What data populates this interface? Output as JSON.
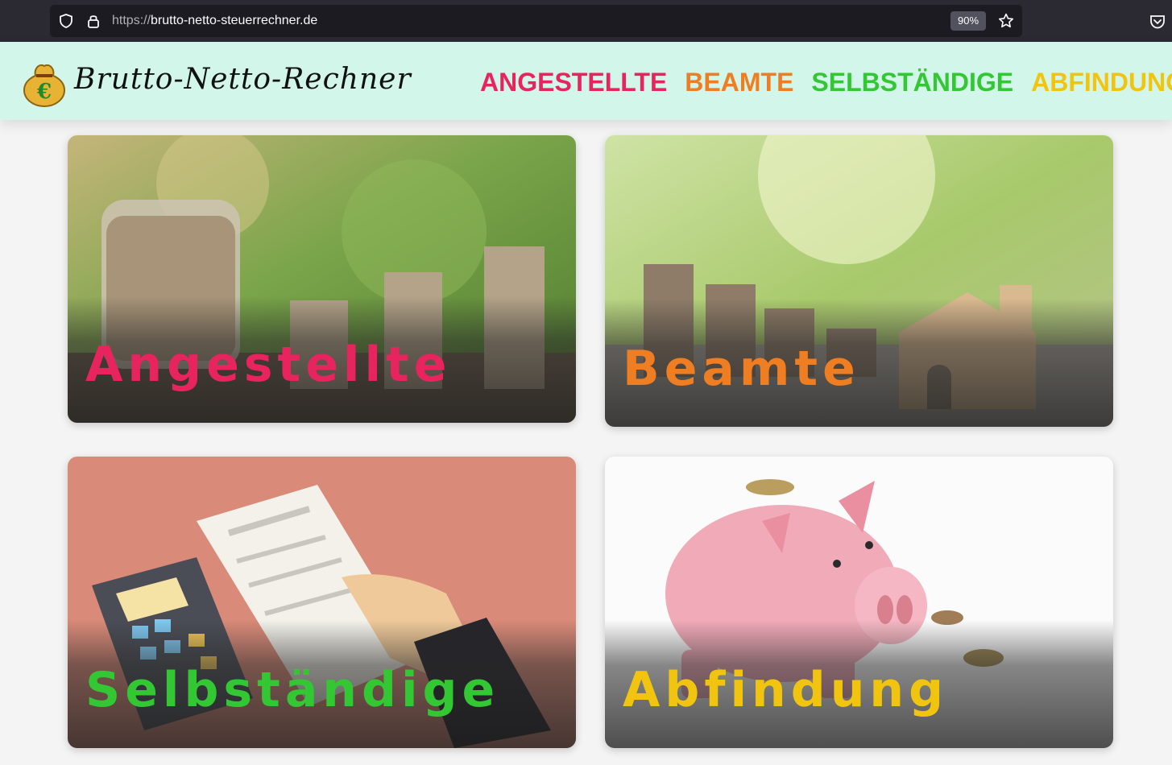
{
  "browser": {
    "url_scheme": "https://",
    "url_host": "brutto-netto-steuerrechner.de",
    "zoom": "90%",
    "icons": [
      "shield-icon",
      "lock-icon",
      "star-icon",
      "pocket-icon"
    ]
  },
  "header": {
    "logo_text": "Brutto-Netto-Rechner",
    "logo_icon": "money-bag-icon",
    "nav": [
      {
        "label": "ANGESTELLTE",
        "color": "#e8245f"
      },
      {
        "label": "BEAMTE",
        "color": "#ef7d22"
      },
      {
        "label": "SELBSTÄNDIGE",
        "color": "#33c734"
      },
      {
        "label": "ABFINDUNG",
        "color": "#f1c40f"
      }
    ],
    "background": "#d2f7ea"
  },
  "cards": [
    {
      "label": "Angestellte",
      "color": "#e8245f",
      "image": "coin-jar-and-stacks"
    },
    {
      "label": "Beamte",
      "color": "#ef7d22",
      "image": "coin-stacks-and-wooden-house"
    },
    {
      "label": "Selbständige",
      "color": "#33c734",
      "image": "calculator-and-invoice"
    },
    {
      "label": "Abfindung",
      "color": "#f1c40f",
      "image": "piggy-bank-with-coins"
    }
  ]
}
